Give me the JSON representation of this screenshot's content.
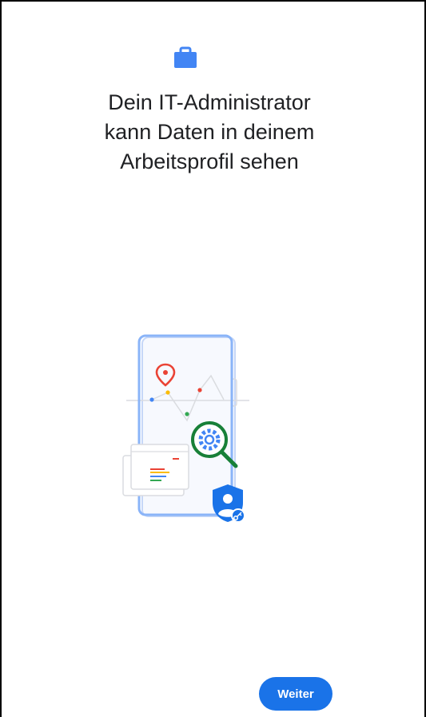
{
  "header": {
    "icon": "briefcase-icon",
    "title_lines": [
      "Dein IT-Administrator",
      "kann Daten in deinem",
      "Arbeitsprofil sehen"
    ]
  },
  "illustration": {
    "icons": [
      "location-pin-icon",
      "magnifier-gear-icon",
      "admin-shield-icon",
      "key-icon"
    ]
  },
  "footer": {
    "continue_label": "Weiter"
  },
  "colors": {
    "accent": "#1a73e8",
    "icon_blue": "#4285f4",
    "red": "#ea4335",
    "yellow": "#fbbc04",
    "green": "#34a853",
    "dark_green": "#188038"
  }
}
